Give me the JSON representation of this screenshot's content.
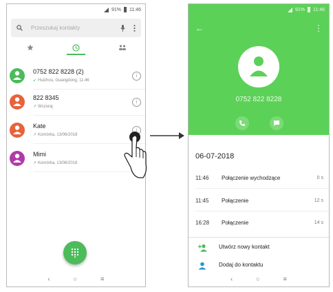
{
  "left_screen": {
    "status": {
      "battery": "91%",
      "time": "11:46"
    },
    "search": {
      "placeholder": "Przeszukaj kontakty"
    },
    "tabs": [
      "favorites",
      "recent",
      "contacts"
    ],
    "calls": [
      {
        "name": "0752 822 8228 (2)",
        "detail": "Huizhou, Guangdong, 11:46",
        "color": "#4cbb5a",
        "direction": "incoming"
      },
      {
        "name": "822 8345",
        "detail": "Wczoraj",
        "color": "#e8623a",
        "direction": "outgoing"
      },
      {
        "name": "Kate",
        "detail": "Komórka, 13/06/2018",
        "color": "#e8623a",
        "direction": "outgoing"
      },
      {
        "name": "Mimi",
        "detail": "Komórka, 13/06/2018",
        "color": "#b03ba8",
        "direction": "outgoing"
      }
    ],
    "nav": {
      "back": "‹",
      "home": "○",
      "recents": "≡"
    }
  },
  "right_screen": {
    "status": {
      "battery": "91%",
      "time": "11:46"
    },
    "phone_number": "0752 822 8228",
    "date": "06-07-2018",
    "log": [
      {
        "time": "11:46",
        "type": "Połączenie wychodzące",
        "duration": "0 s"
      },
      {
        "time": "11:45",
        "type": "Połączenie",
        "duration": "12 s"
      },
      {
        "time": "16:28",
        "type": "Połączenie",
        "duration": "14 s"
      }
    ],
    "actions": [
      {
        "label": "Utwórz nowy kontakt"
      },
      {
        "label": "Dodaj do kontaktu"
      }
    ],
    "nav": {
      "back": "‹",
      "home": "○",
      "recents": "≡"
    }
  },
  "colors": {
    "accent": "#4cbb5a",
    "header": "#5cd158"
  }
}
